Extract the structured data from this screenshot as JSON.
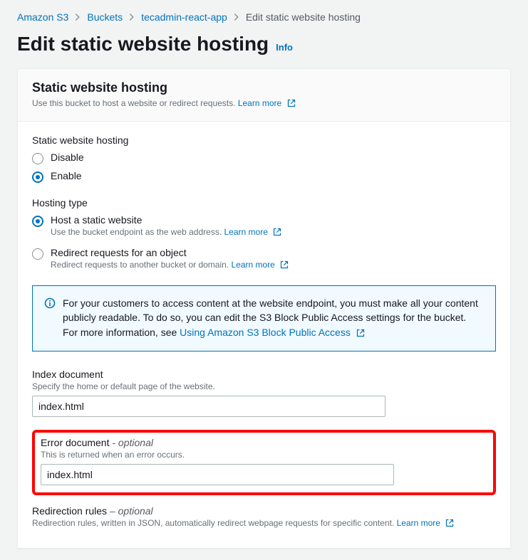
{
  "breadcrumb": {
    "items": [
      {
        "label": "Amazon S3"
      },
      {
        "label": "Buckets"
      },
      {
        "label": "tecadmin-react-app"
      }
    ],
    "current": "Edit static website hosting"
  },
  "pageTitle": "Edit static website hosting",
  "infoLabel": "Info",
  "panel": {
    "title": "Static website hosting",
    "desc": "Use this bucket to host a website or redirect requests.",
    "learnMore": "Learn more"
  },
  "hostingRadio": {
    "label": "Static website hosting",
    "disable": "Disable",
    "enable": "Enable"
  },
  "hostingType": {
    "label": "Hosting type",
    "optStatic": "Host a static website",
    "optStaticDesc": "Use the bucket endpoint as the web address.",
    "optRedirect": "Redirect requests for an object",
    "optRedirectDesc": "Redirect requests to another bucket or domain.",
    "learnMore": "Learn more"
  },
  "alert": {
    "text": "For your customers to access content at the website endpoint, you must make all your content publicly readable. To do so, you can edit the S3 Block Public Access settings for the bucket. For more information, see ",
    "link": "Using Amazon S3 Block Public Access"
  },
  "indexDoc": {
    "label": "Index document",
    "hint": "Specify the home or default page of the website.",
    "value": "index.html"
  },
  "errorDoc": {
    "label": "Error document",
    "optional": "- optional",
    "hint": "This is returned when an error occurs.",
    "value": "index.html"
  },
  "redirRules": {
    "label": "Redirection rules",
    "optional": "– optional",
    "hint": "Redirection rules, written in JSON, automatically redirect webpage requests for specific content.",
    "learnMore": "Learn more"
  }
}
